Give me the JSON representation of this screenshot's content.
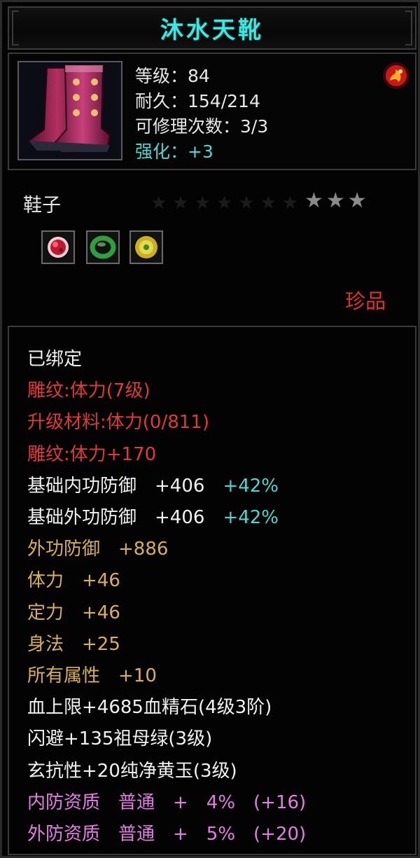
{
  "title": "沐水天靴",
  "stats": {
    "level": "等级：84",
    "durability": "耐久：154/214",
    "repair": "可修理次数：3/3",
    "enhance": "强化：+3"
  },
  "item_type": "鞋子",
  "stars": "★★★",
  "rarity": "珍品",
  "icons": {
    "item": "boots-icon",
    "corner": "fire-emblem-icon",
    "gems": [
      "red-gem-icon",
      "green-jade-ring-icon",
      "yellow-jade-icon"
    ]
  },
  "colors": {
    "title": "#3fe6e0",
    "enhance": "#4fd6d0",
    "red": "#e03a3a",
    "gold": "#d8b05a",
    "pink": "#e27fe0"
  },
  "attributes": {
    "bound": "已绑定",
    "engrave": "雕纹:体力(7级)",
    "upgrade_material": "升级材料:体力(0/811)",
    "engrave_bonus": "雕纹:体力+170",
    "base_inner_def": "基础内功防御　+406",
    "base_inner_def_pct": "+42%",
    "base_outer_def": "基础外功防御　+406",
    "base_outer_def_pct": "+42%",
    "outer_def": "外功防御　+886",
    "stamina": "体力　+46",
    "focus": "定力　+46",
    "agility": "身法　+25",
    "all_attr": "所有属性　+10",
    "hp_gem": "血上限+4685血精石(4级3阶)",
    "dodge_gem": "闪避+135祖母绿(3级)",
    "xuan_gem": "玄抗性+20纯净黄玉(3级)",
    "inner_quality": "内防资质　普通　+　4%　(+16)",
    "outer_quality": "外防资质　普通　+　5%　(+20)"
  }
}
